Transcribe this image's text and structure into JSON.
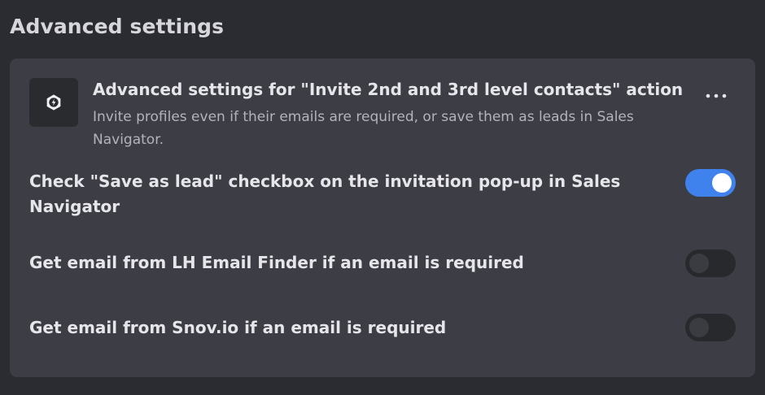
{
  "page": {
    "title": "Advanced settings"
  },
  "action": {
    "icon": "gear-lightning-icon",
    "title": "Advanced settings for \"Invite 2nd and 3rd level contacts\" action",
    "description": "Invite profiles even if their emails are required, or save them as leads in Sales Navigator.",
    "more_icon": "more-horizontal-icon"
  },
  "settings": [
    {
      "label": "Check \"Save as lead\" checkbox on the invitation pop-up in Sales Navigator",
      "enabled": true
    },
    {
      "label": "Get email from LH Email Finder if an email is required",
      "enabled": false
    },
    {
      "label": "Get email from Snov.io if an email is required",
      "enabled": false
    }
  ],
  "colors": {
    "page_background": "#2b2c31",
    "card_background": "#3d3e45",
    "toggle_on": "#3f82ee",
    "toggle_off": "#28292d"
  }
}
